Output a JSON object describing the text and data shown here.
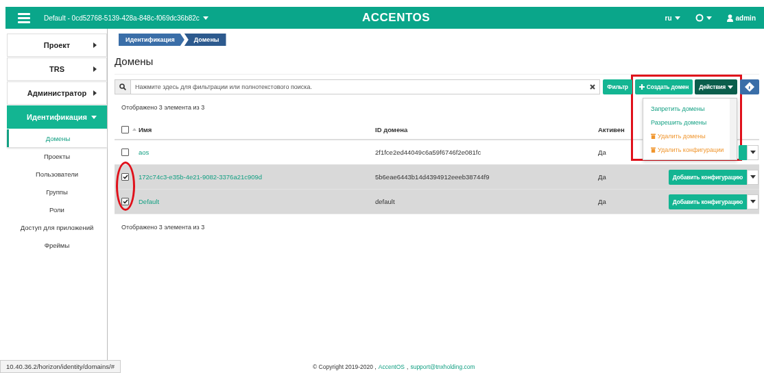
{
  "navbar": {
    "project": "Default - 0cd52768-5139-428a-848c-f069dc36b82c",
    "logo": "ACCENTOS",
    "language": "ru",
    "user": "admin"
  },
  "sidebar": {
    "items": [
      {
        "label": "Проект",
        "expanded": false
      },
      {
        "label": "TRS",
        "expanded": false
      },
      {
        "label": "Администратор",
        "expanded": false
      },
      {
        "label": "Идентификация",
        "expanded": true,
        "children": [
          {
            "label": "Домены",
            "selected": true
          },
          {
            "label": "Проекты",
            "selected": false
          },
          {
            "label": "Пользователи",
            "selected": false
          },
          {
            "label": "Группы",
            "selected": false
          },
          {
            "label": "Роли",
            "selected": false
          },
          {
            "label": "Доступ для приложений",
            "selected": false
          },
          {
            "label": "Фреймы",
            "selected": false
          }
        ]
      }
    ]
  },
  "breadcrumb": [
    "Идентификация",
    "Домены"
  ],
  "title": "Домены",
  "search": {
    "placeholder": "Нажмите здесь для фильтрации или полнотекстового поиска."
  },
  "toolbar": {
    "filter": "Фильтр",
    "create": "Создать домен",
    "actions": "Действия"
  },
  "actions_menu": [
    {
      "label": "Запретить домены",
      "kind": "normal"
    },
    {
      "label": "Разрешить домены",
      "kind": "normal"
    },
    {
      "label": "Удалить домены",
      "kind": "danger"
    },
    {
      "label": "Удалить конфигурации",
      "kind": "danger"
    }
  ],
  "table": {
    "count_top": "Отображено 3 элемента из 3",
    "columns": [
      "Имя",
      "ID домена",
      "Активен"
    ],
    "all_checked": false,
    "rows": [
      {
        "checked": false,
        "name": "aos",
        "id": "2f1fce2ed44049c6a59f6746f2e081fc",
        "active": "Да"
      },
      {
        "checked": true,
        "name": "172c74c3-e35b-4e21-9082-3376a21c909d",
        "id": "5b6eae6443b14d4394912eeeb38744f9",
        "active": "Да",
        "action": "Добавить конфигурацию"
      },
      {
        "checked": true,
        "name": "Default",
        "id": "default",
        "active": "Да",
        "action": "Добавить конфигурацию"
      }
    ],
    "count_bottom": "Отображено 3 элемента из 3"
  },
  "status_url": "10.40.36.2/horizon/identity/domains/#",
  "footer": {
    "copyright": "© Copyright 2019-2020 ,",
    "brand": "AccentOS",
    "separator": ",",
    "email": "support@tnxholding.com"
  }
}
